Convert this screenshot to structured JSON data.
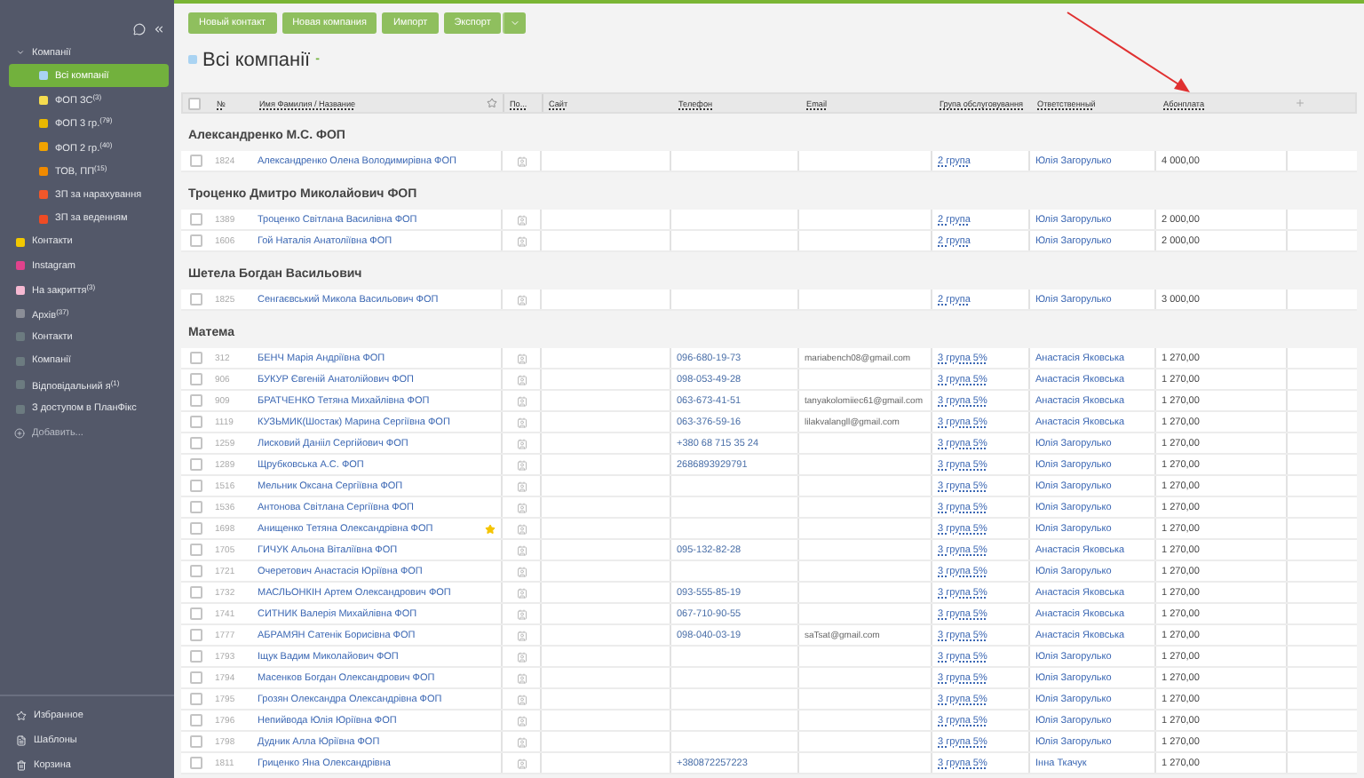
{
  "sidebar": {
    "items": [
      {
        "label": "Компанії",
        "expanded": true,
        "children": [
          {
            "label": "Всі компанії",
            "color": "#a9d3f2",
            "selected": true
          },
          {
            "label": "ФОП ЗС",
            "count": "(3)",
            "color": "#f5dc4e",
            "selected": false
          },
          {
            "label": "ФОП 3 гр.",
            "count": "(79)",
            "color": "#e9b800",
            "selected": false
          },
          {
            "label": "ФОП 2 гр.",
            "count": "(40)",
            "color": "#f2a300",
            "selected": false
          },
          {
            "label": "ТОВ, ПП",
            "count": "(15)",
            "color": "#f08a00",
            "selected": false
          },
          {
            "label": "ЗП за нарахування",
            "color": "#f0572a",
            "selected": false
          },
          {
            "label": "ЗП за веденням",
            "color": "#ee4b24",
            "selected": false
          }
        ]
      },
      {
        "label": "Контакти",
        "color": "#f2c800",
        "selected": false
      },
      {
        "label": "Instagram",
        "color": "#e1428c",
        "selected": false
      },
      {
        "label": "На закриття",
        "count": "(3)",
        "color": "#f6b9d2",
        "selected": false
      },
      {
        "label": "Архів",
        "count": "(37)",
        "color": "#8b8e97",
        "selected": false
      },
      {
        "label": "Контакти",
        "color": "#6c7b80",
        "selected": false
      },
      {
        "label": "Компанії",
        "color": "#6c7b80",
        "selected": false
      },
      {
        "label": "Відповідальний я",
        "count": "(1)",
        "color": "#6c7b80",
        "selected": false
      },
      {
        "label": "З доступом в ПланФікс",
        "color": "#6c7b80",
        "selected": false
      }
    ],
    "add_label": "Добавить...",
    "bottom": [
      {
        "kind": "favorites",
        "label": "Избранное"
      },
      {
        "kind": "templates",
        "label": "Шаблоны"
      },
      {
        "kind": "trash",
        "label": "Корзина"
      }
    ]
  },
  "toolbar": {
    "buttons": [
      "Новый контакт",
      "Новая компания",
      "Импорт",
      "Экспорт"
    ]
  },
  "title": {
    "text": "Всі компанії",
    "suffix": "-",
    "color": "#a9d3f2"
  },
  "table": {
    "all_checked": false,
    "columns": [
      "№",
      "Имя Фамилия / Название",
      "По...",
      "Сайт",
      "Телефон",
      "Email",
      "Група обслуговування",
      "Ответственный",
      "Абонплата"
    ],
    "groups": [
      {
        "title": "Александренко М.С. ФОП",
        "rows": [
          {
            "id": "1824",
            "name": "Александренко Олена Володимирівна ФОП",
            "checked": false,
            "starred": false,
            "group": "2 група",
            "responsible": "Юлія Загорулько",
            "fee": "4 000,00"
          }
        ]
      },
      {
        "title": "Троценко Дмитро Миколайович ФОП",
        "rows": [
          {
            "id": "1389",
            "name": "Троценко Світлана Василівна ФОП",
            "checked": false,
            "starred": false,
            "group": "2 група",
            "responsible": "Юлія Загорулько",
            "fee": "2 000,00"
          },
          {
            "id": "1606",
            "name": "Гой Наталія Анатоліївна ФОП",
            "checked": false,
            "starred": false,
            "group": "2 група",
            "responsible": "Юлія Загорулько",
            "fee": "2 000,00"
          }
        ]
      },
      {
        "title": "Шетела Богдан Васильович",
        "rows": [
          {
            "id": "1825",
            "name": "Сенгаєвський Микола Васильович ФОП",
            "checked": false,
            "starred": false,
            "group": "2 група",
            "responsible": "Юлія Загорулько",
            "fee": "3 000,00"
          }
        ]
      },
      {
        "title": "Матема",
        "rows": [
          {
            "id": "312",
            "name": "БЕНЧ Марія Андріївна ФОП",
            "checked": false,
            "starred": false,
            "phone": "096-680-19-73",
            "email": "mariabench08@gmail.com",
            "group": "3 група 5%",
            "responsible": "Анастасія Яковська",
            "fee": "1 270,00"
          },
          {
            "id": "906",
            "name": "БУКУР Євгеній Анатолійович ФОП",
            "checked": false,
            "starred": false,
            "phone": "098-053-49-28",
            "group": "3 група 5%",
            "responsible": "Анастасія Яковська",
            "fee": "1 270,00"
          },
          {
            "id": "909",
            "name": "БРАТЧЕНКО Тетяна Михайлівна ФОП",
            "checked": false,
            "starred": false,
            "phone": "063-673-41-51",
            "email": "tanyakolomiiec61@gmail.com",
            "group": "3 група 5%",
            "responsible": "Анастасія Яковська",
            "fee": "1 270,00"
          },
          {
            "id": "1119",
            "name": "КУЗЬМИК(Шостак) Марина Сергіївна ФОП",
            "checked": false,
            "starred": false,
            "phone": "063-376-59-16",
            "email": "lilakvalangll@gmail.com",
            "group": "3 група 5%",
            "responsible": "Анастасія Яковська",
            "fee": "1 270,00"
          },
          {
            "id": "1259",
            "name": "Лисковий Данііл Сергійович ФОП",
            "checked": false,
            "starred": false,
            "phone": "+380 68 715 35 24",
            "group": "3 група 5%",
            "responsible": "Юлія Загорулько",
            "fee": "1 270,00"
          },
          {
            "id": "1289",
            "name": "Щрубковська А.С. ФОП",
            "checked": false,
            "starred": false,
            "phone": "2686893929791",
            "group": "3 група 5%",
            "responsible": "Юлія Загорулько",
            "fee": "1 270,00"
          },
          {
            "id": "1516",
            "name": "Мельник Оксана Сергіївна ФОП",
            "checked": false,
            "starred": false,
            "group": "3 група 5%",
            "responsible": "Юлія Загорулько",
            "fee": "1 270,00"
          },
          {
            "id": "1536",
            "name": "Антонова Світлана Сергіївна ФОП",
            "checked": false,
            "starred": false,
            "group": "3 група 5%",
            "responsible": "Юлія Загорулько",
            "fee": "1 270,00"
          },
          {
            "id": "1698",
            "name": "Анищенко Тетяна Олександрівна ФОП",
            "checked": false,
            "starred": true,
            "group": "3 група 5%",
            "responsible": "Юлія Загорулько",
            "fee": "1 270,00"
          },
          {
            "id": "1705",
            "name": "ГИЧУК Альона Віталіївна ФОП",
            "checked": false,
            "starred": false,
            "phone": "095-132-82-28",
            "group": "3 група 5%",
            "responsible": "Анастасія Яковська",
            "fee": "1 270,00"
          },
          {
            "id": "1721",
            "name": "Очеретович Анастасія Юріївна ФОП",
            "checked": false,
            "starred": false,
            "group": "3 група 5%",
            "responsible": "Юлія Загорулько",
            "fee": "1 270,00"
          },
          {
            "id": "1732",
            "name": "МАСЛЬОНКІН Артем Олександрович ФОП",
            "checked": false,
            "starred": false,
            "phone": "093-555-85-19",
            "group": "3 група 5%",
            "responsible": "Анастасія Яковська",
            "fee": "1 270,00"
          },
          {
            "id": "1741",
            "name": "СИТНИК Валерія Михайлівна ФОП",
            "checked": false,
            "starred": false,
            "phone": "067-710-90-55",
            "group": "3 група 5%",
            "responsible": "Анастасія Яковська",
            "fee": "1 270,00"
          },
          {
            "id": "1777",
            "name": "АБРАМЯН Сатенік Борисівна ФОП",
            "checked": false,
            "starred": false,
            "phone": "098-040-03-19",
            "email": "saTsat@gmail.com",
            "group": "3 група 5%",
            "responsible": "Анастасія Яковська",
            "fee": "1 270,00"
          },
          {
            "id": "1793",
            "name": "Іщук Вадим Миколайович ФОП",
            "checked": false,
            "starred": false,
            "group": "3 група 5%",
            "responsible": "Юлія Загорулько",
            "fee": "1 270,00"
          },
          {
            "id": "1794",
            "name": "Масенков Богдан Олександрович ФОП",
            "checked": false,
            "starred": false,
            "group": "3 група 5%",
            "responsible": "Юлія Загорулько",
            "fee": "1 270,00"
          },
          {
            "id": "1795",
            "name": "Грозян Олександра Олександрівна ФОП",
            "checked": false,
            "starred": false,
            "group": "3 група 5%",
            "responsible": "Юлія Загорулько",
            "fee": "1 270,00"
          },
          {
            "id": "1796",
            "name": "Непийвода Юлія Юріївна ФОП",
            "checked": false,
            "starred": false,
            "group": "3 група 5%",
            "responsible": "Юлія Загорулько",
            "fee": "1 270,00"
          },
          {
            "id": "1798",
            "name": "Дудник Алла Юріївна ФОП",
            "checked": false,
            "starred": false,
            "group": "3 група 5%",
            "responsible": "Юлія Загорулько",
            "fee": "1 270,00"
          },
          {
            "id": "1811",
            "name": "Гриценко Яна Олександрівна",
            "checked": false,
            "starred": false,
            "phone": "+380872257223",
            "group": "3 група 5%",
            "responsible": "Інна Ткачук",
            "fee": "1 270,00"
          }
        ]
      }
    ]
  }
}
